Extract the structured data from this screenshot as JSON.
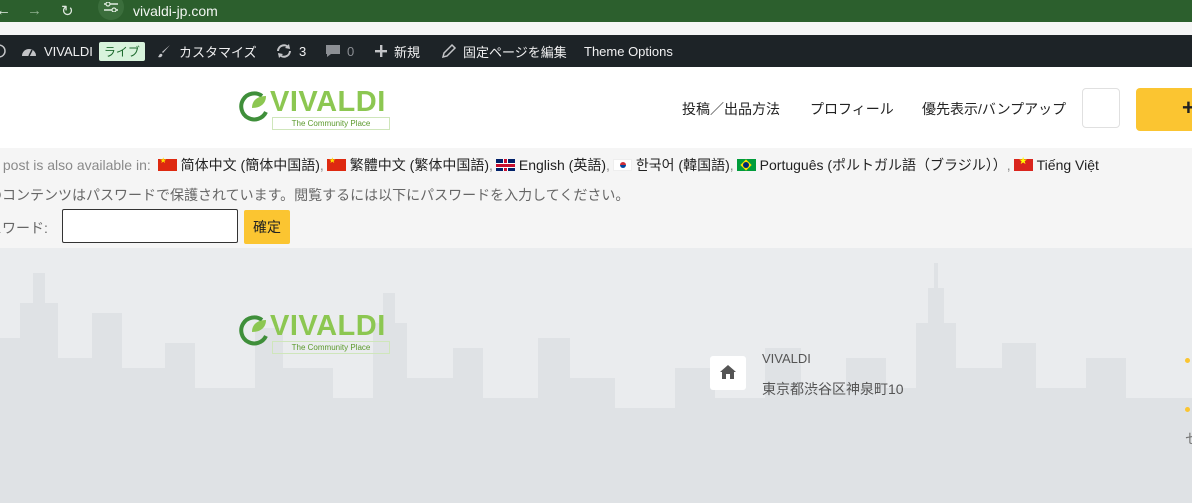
{
  "browser": {
    "url": "vivaldi-jp.com"
  },
  "adminbar": {
    "site_name": "VIVALDI",
    "live_badge": "ライブ",
    "customize": "カスタマイズ",
    "updates_count": "3",
    "comments_count": "0",
    "new": "新規",
    "edit_page": "固定ページを編集",
    "theme_options": "Theme Options"
  },
  "header": {
    "logo": {
      "name": "VIVALDI",
      "tagline": "The Community Place"
    },
    "menu": [
      "投稿／出品方法",
      "プロフィール",
      "優先表示/バンプアップ"
    ],
    "cta_label": "+"
  },
  "content": {
    "lang_prefix": "s post is also available in:",
    "languages": [
      {
        "flag": "cn",
        "label": "简体中文 (簡体中国語)",
        "sep": ","
      },
      {
        "flag": "cn",
        "label": "繁體中文 (繁体中国語)",
        "sep": ","
      },
      {
        "flag": "uk",
        "label": "English (英語)",
        "sep": ","
      },
      {
        "flag": "kr",
        "label": "한국어 (韓国語)",
        "sep": ","
      },
      {
        "flag": "br",
        "label": "Português (ポルトガル語（ブラジル））",
        "sep": ","
      },
      {
        "flag": "vn",
        "label": "Tiếng Việt",
        "sep": ""
      }
    ],
    "protected_message": "のコンテンツはパスワードで保護されています。閲覧するには以下にパスワードを入力してください。",
    "password_label": "スワード:",
    "password_value": "",
    "submit_label": "確定"
  },
  "footer": {
    "logo": {
      "name": "VIVALDI",
      "tagline": "The Community Place"
    },
    "address_name": "VIVALDI",
    "address": "東京都渋谷区神泉町10",
    "edge_text": "セ"
  },
  "colors": {
    "accent": "#fbc531",
    "logo_green": "#8cc751",
    "adminbar_bg": "#1d2327",
    "browser_bar": "#2c5f2d"
  }
}
